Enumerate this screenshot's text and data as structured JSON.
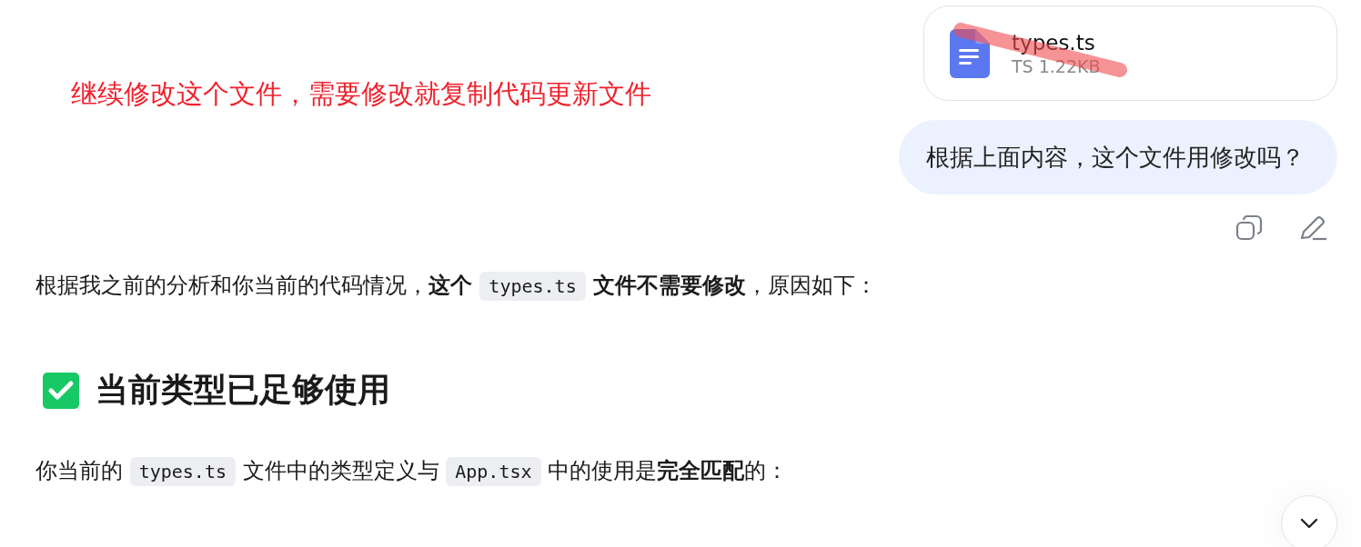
{
  "annotation": {
    "text": "继续修改这个文件，需要修改就复制代码更新文件"
  },
  "user_message": {
    "attachment": {
      "name": "types.ts",
      "meta": "TS 1.22KB"
    },
    "text": "根据上面内容，这个文件用修改吗？"
  },
  "answer": [
    {
      "kind": "paragraph",
      "segments": [
        {
          "kind": "text",
          "text": "根据我之前的分析和你当前的代码情况，"
        },
        {
          "kind": "bold",
          "text": "这个 "
        },
        {
          "kind": "code",
          "text": "types.ts"
        },
        {
          "kind": "bold",
          "text": " 文件不需要修改"
        },
        {
          "kind": "text",
          "text": "，原因如下："
        }
      ]
    },
    {
      "kind": "heading",
      "text": "当前类型已足够使用"
    },
    {
      "kind": "paragraph",
      "segments": [
        {
          "kind": "text",
          "text": "你当前的 "
        },
        {
          "kind": "code",
          "text": "types.ts"
        },
        {
          "kind": "text",
          "text": " 文件中的类型定义与 "
        },
        {
          "kind": "code",
          "text": "App.tsx"
        },
        {
          "kind": "text",
          "text": " 中的使用是"
        },
        {
          "kind": "bold",
          "text": "完全匹配"
        },
        {
          "kind": "text",
          "text": "的："
        }
      ]
    }
  ]
}
